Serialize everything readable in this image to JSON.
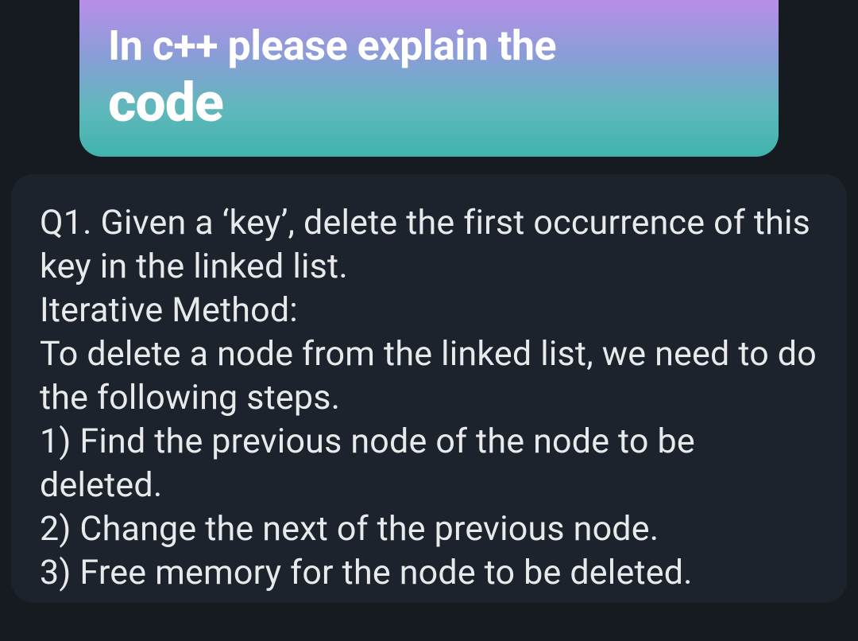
{
  "header": {
    "line1": "In c++ please explain the",
    "line2": "code"
  },
  "content": {
    "q_intro": "Q1. Given a ‘key’, delete the first occurrence of this key in the linked list.",
    "method_label": "Iterative Method:",
    "method_intro": "To delete a node from the linked list, we need to do the following steps.",
    "step1": "1) Find the previous node of the node to be deleted.",
    "step2": "2) Change the next of the previous node.",
    "step3": "3) Free memory for the node to be deleted."
  }
}
